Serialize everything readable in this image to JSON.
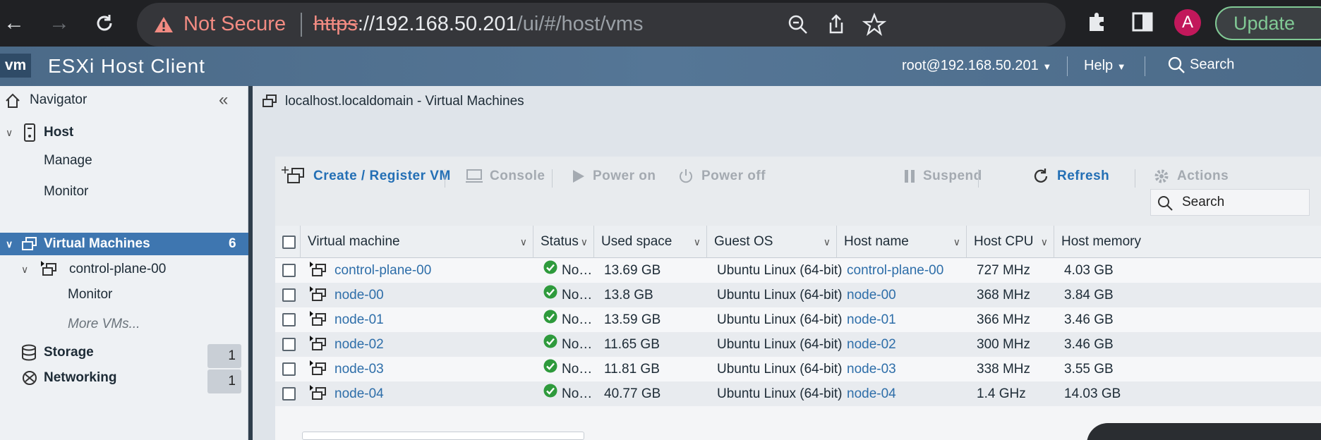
{
  "browser": {
    "security_label": "Not Secure",
    "url_scheme": "https",
    "url_host": "://192.168.50.201",
    "url_path": "/ui/#/host/vms",
    "avatar_letter": "A",
    "update_label": "Update"
  },
  "header": {
    "logo": "vm",
    "title": "ESXi Host Client",
    "user": "root@192.168.50.201",
    "help": "Help",
    "search": "Search"
  },
  "navigator": {
    "title": "Navigator",
    "host": "Host",
    "manage": "Manage",
    "monitor": "Monitor",
    "virtual_machines": "Virtual Machines",
    "vm_count": "6",
    "control_plane": "control-plane-00",
    "vm_monitor": "Monitor",
    "more_vms": "More VMs...",
    "storage": "Storage",
    "storage_count": "1",
    "networking": "Networking",
    "networking_count": "1"
  },
  "main": {
    "breadcrumb": "localhost.localdomain - Virtual Machines",
    "toolbar": {
      "create": "Create / Register VM",
      "console": "Console",
      "power_on": "Power on",
      "power_off": "Power off",
      "suspend": "Suspend",
      "refresh": "Refresh",
      "actions": "Actions"
    },
    "search_placeholder": "Search",
    "columns": [
      "Virtual machine",
      "Status",
      "Used space",
      "Guest OS",
      "Host name",
      "Host CPU",
      "Host memory"
    ],
    "rows": [
      {
        "name": "control-plane-00",
        "status": "No...",
        "used": "13.69 GB",
        "os": "Ubuntu Linux (64-bit)",
        "host": "control-plane-00",
        "cpu": "727 MHz",
        "mem": "4.03 GB"
      },
      {
        "name": "node-00",
        "status": "No...",
        "used": "13.8 GB",
        "os": "Ubuntu Linux (64-bit)",
        "host": "node-00",
        "cpu": "368 MHz",
        "mem": "3.84 GB"
      },
      {
        "name": "node-01",
        "status": "No...",
        "used": "13.59 GB",
        "os": "Ubuntu Linux (64-bit)",
        "host": "node-01",
        "cpu": "366 MHz",
        "mem": "3.46 GB"
      },
      {
        "name": "node-02",
        "status": "No...",
        "used": "11.65 GB",
        "os": "Ubuntu Linux (64-bit)",
        "host": "node-02",
        "cpu": "300 MHz",
        "mem": "3.46 GB"
      },
      {
        "name": "node-03",
        "status": "No...",
        "used": "11.81 GB",
        "os": "Ubuntu Linux (64-bit)",
        "host": "node-03",
        "cpu": "338 MHz",
        "mem": "3.55 GB"
      },
      {
        "name": "node-04",
        "status": "No...",
        "used": "40.77 GB",
        "os": "Ubuntu Linux (64-bit)",
        "host": "node-04",
        "cpu": "1.4 GHz",
        "mem": "14.03 GB"
      }
    ]
  }
}
